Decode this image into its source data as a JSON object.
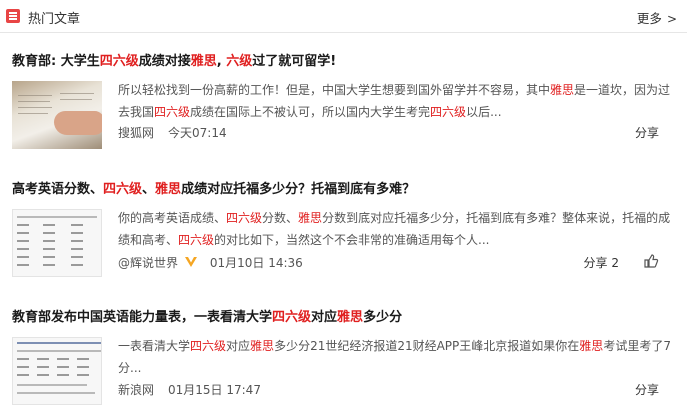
{
  "header": {
    "title": "热门文章",
    "more_label": "更多",
    "more_chevron": ">"
  },
  "articles": [
    {
      "title": [
        {
          "t": "教育部: 大学生",
          "h": false
        },
        {
          "t": "四六级",
          "h": true
        },
        {
          "t": "成绩对接",
          "h": false
        },
        {
          "t": "雅思",
          "h": true
        },
        {
          "t": ", ",
          "h": false
        },
        {
          "t": "六级",
          "h": true
        },
        {
          "t": "过了就可留学!",
          "h": false
        }
      ],
      "snippet": [
        {
          "t": "所以轻松找到一份高薪的工作！但是，中国大学生想要到国外留学并不容易，其中",
          "h": false
        },
        {
          "t": "雅思",
          "h": true
        },
        {
          "t": "是一道坎，因为过去我国",
          "h": false
        },
        {
          "t": "四六级",
          "h": true
        },
        {
          "t": "成绩在国际上不被认可，所以国内大学生考完",
          "h": false
        },
        {
          "t": "四六级",
          "h": true
        },
        {
          "t": "以后...",
          "h": false
        }
      ],
      "source": "搜狐网",
      "time": "今天07:14",
      "share_label": "分享",
      "thumbnail": "open-book-photo"
    },
    {
      "title": [
        {
          "t": "高考英语分数、",
          "h": false
        },
        {
          "t": "四六级",
          "h": true
        },
        {
          "t": "、",
          "h": false
        },
        {
          "t": "雅思",
          "h": true
        },
        {
          "t": "成绩对应托福多少分？托福到底有多难？",
          "h": false
        }
      ],
      "snippet": [
        {
          "t": "你的高考英语成绩、",
          "h": false
        },
        {
          "t": "四六级",
          "h": true
        },
        {
          "t": "分数、",
          "h": false
        },
        {
          "t": "雅思",
          "h": true
        },
        {
          "t": "分数到底对应托福多少分，托福到底有多难？整体来说，托福的成绩和高考、",
          "h": false
        },
        {
          "t": "四六级",
          "h": true
        },
        {
          "t": "的对比如下，当然这个不会非常的准确适用每个人...",
          "h": false
        }
      ],
      "source": "@辉说世界",
      "verified_icon": "verified-v-icon",
      "time": "01月10日 14:36",
      "share_label": "分享 2",
      "like_icon": "thumbs-up-icon",
      "thumbnail": "score-table-image"
    },
    {
      "title": [
        {
          "t": "教育部发布中国英语能力量表，一表看清大学",
          "h": false
        },
        {
          "t": "四六级",
          "h": true
        },
        {
          "t": "对应",
          "h": false
        },
        {
          "t": "雅思",
          "h": true
        },
        {
          "t": "多少分",
          "h": false
        }
      ],
      "snippet": [
        {
          "t": "一表看清大学",
          "h": false
        },
        {
          "t": "四六级",
          "h": true
        },
        {
          "t": "对应",
          "h": false
        },
        {
          "t": "雅思",
          "h": true
        },
        {
          "t": "多少分21世纪经济报道21财经APP王峰北京报道如果你在",
          "h": false
        },
        {
          "t": "雅思",
          "h": true
        },
        {
          "t": "考试里考了7分...",
          "h": false
        }
      ],
      "source": "新浪网",
      "time": "01月15日 17:47",
      "share_label": "分享",
      "thumbnail": "ability-scale-table-image"
    }
  ],
  "colors": {
    "highlight": "#e02020",
    "verified": "#f5a623",
    "header_icon": "#e84545"
  }
}
